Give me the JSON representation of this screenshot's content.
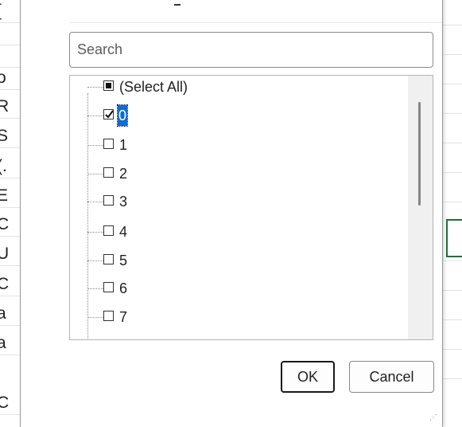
{
  "background_sheet": {
    "left_cells": [
      "[",
      "",
      "",
      "o",
      "R",
      "S",
      "(.",
      "E",
      "C",
      "U",
      "C",
      "a",
      "a",
      "C"
    ]
  },
  "filter": {
    "search": {
      "placeholder": "Search",
      "value": ""
    },
    "items": [
      {
        "label": "(Select All)",
        "state": "partial"
      },
      {
        "label": "0",
        "state": "checked",
        "selected": true
      },
      {
        "label": "1",
        "state": "unchecked"
      },
      {
        "label": "2",
        "state": "unchecked"
      },
      {
        "label": "3",
        "state": "unchecked"
      },
      {
        "label": "4",
        "state": "unchecked"
      },
      {
        "label": "5",
        "state": "unchecked"
      },
      {
        "label": "6",
        "state": "unchecked"
      },
      {
        "label": "7",
        "state": "unchecked"
      },
      {
        "label": "",
        "state": "unchecked"
      }
    ],
    "ok_label": "OK",
    "cancel_label": "Cancel"
  },
  "colors": {
    "selection": "#0f6cd0",
    "active_cell_border": "#1e6f3d"
  }
}
